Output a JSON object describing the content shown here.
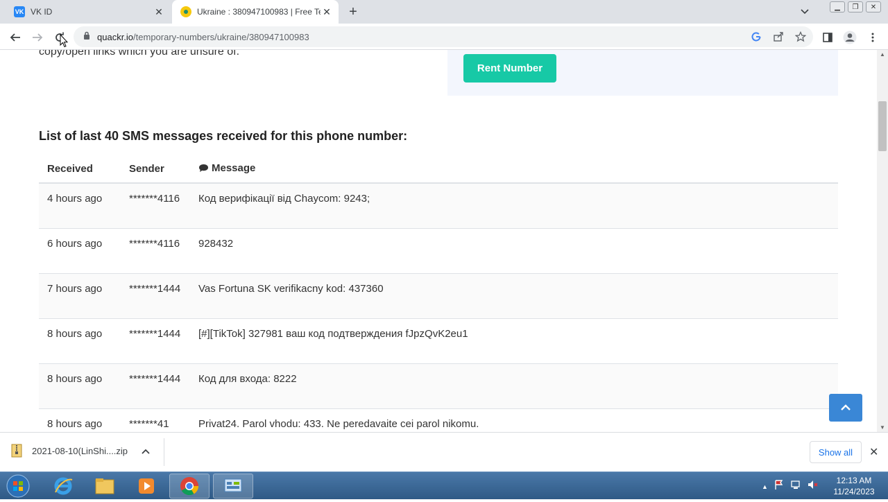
{
  "browser": {
    "tabs": [
      {
        "title": "VK ID",
        "favicon": "vk-icon",
        "active": false
      },
      {
        "title": "Ukraine : 380947100983 | Free Te",
        "favicon": "quackr-icon",
        "active": true
      }
    ],
    "url_host": "quackr.io",
    "url_path": "/temporary-numbers/ukraine/380947100983"
  },
  "page": {
    "partial_text": "copy/open links which you are unsure of.",
    "rent_button": "Rent Number",
    "list_heading": "List of last 40 SMS messages received for this phone number:",
    "table": {
      "headers": [
        "Received",
        "Sender",
        "Message"
      ],
      "rows": [
        {
          "received": "4 hours ago",
          "sender": "*******4116",
          "message": "Код верифікації від Chaycom: 9243;"
        },
        {
          "received": "6 hours ago",
          "sender": "*******4116",
          "message": "928432"
        },
        {
          "received": "7 hours ago",
          "sender": "*******1444",
          "message": "Vas Fortuna SK verifikacny kod: 437360"
        },
        {
          "received": "8 hours ago",
          "sender": "*******1444",
          "message": "[#][TikTok] 327981 ваш код подтверждения fJpzQvK2eu1"
        },
        {
          "received": "8 hours ago",
          "sender": "*******1444",
          "message": "Код для входа: 8222"
        },
        {
          "received": "8 hours ago",
          "sender": "*******41",
          "message": "Privat24. Parol vhodu: 433. Ne peredavaite cei parol nikomu."
        }
      ]
    }
  },
  "downloads": {
    "file": "2021-08-10(LinShi....zip",
    "show_all": "Show all"
  },
  "taskbar": {
    "time": "12:13 AM",
    "date": "11/24/2023"
  },
  "colors": {
    "accent": "#17c9a6",
    "scroll_top_button": "#3a87d6",
    "link_blue": "#1a73e8"
  }
}
